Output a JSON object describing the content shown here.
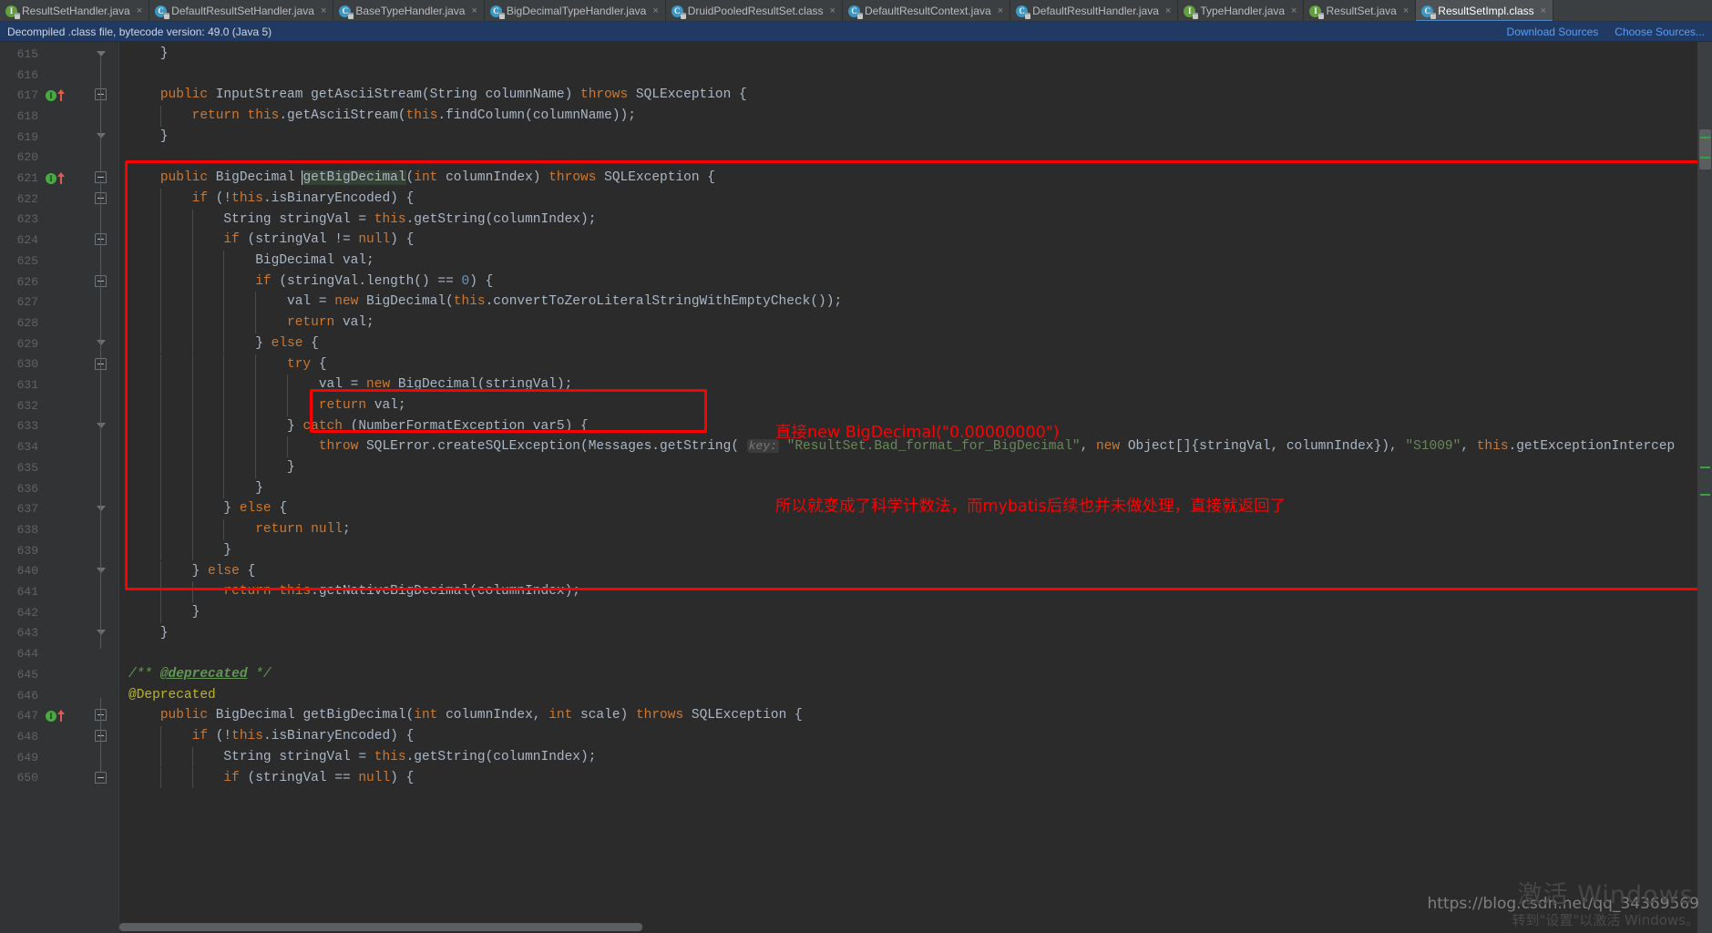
{
  "tabs": [
    {
      "label": "ResultSetHandler.java",
      "icon": "interface-icon",
      "kind": "itf",
      "active": false,
      "closable": true
    },
    {
      "label": "DefaultResultSetHandler.java",
      "icon": "class-icon",
      "kind": "cls",
      "active": false,
      "closable": true
    },
    {
      "label": "BaseTypeHandler.java",
      "icon": "class-icon",
      "kind": "cls",
      "active": false,
      "closable": true
    },
    {
      "label": "BigDecimalTypeHandler.java",
      "icon": "class-icon",
      "kind": "cls",
      "active": false,
      "closable": true
    },
    {
      "label": "DruidPooledResultSet.class",
      "icon": "class-icon",
      "kind": "cls",
      "active": false,
      "closable": true
    },
    {
      "label": "DefaultResultContext.java",
      "icon": "class-icon",
      "kind": "cls",
      "active": false,
      "closable": true
    },
    {
      "label": "DefaultResultHandler.java",
      "icon": "class-icon",
      "kind": "cls",
      "active": false,
      "closable": true
    },
    {
      "label": "TypeHandler.java",
      "icon": "interface-icon",
      "kind": "itf",
      "active": false,
      "closable": true
    },
    {
      "label": "ResultSet.java",
      "icon": "interface-icon",
      "kind": "itf",
      "active": false,
      "closable": true
    },
    {
      "label": "ResultSetImpl.class",
      "icon": "class-icon",
      "kind": "cls",
      "active": true,
      "closable": true
    }
  ],
  "tab_close_glyph": "×",
  "notification": {
    "message": "Decompiled .class file, bytecode version: 49.0 (Java 5)",
    "download_sources_label": "Download Sources",
    "choose_sources_label": "Choose Sources..."
  },
  "editor": {
    "first_line_number": 615,
    "selected_identifier": "getBigDecimal",
    "lines": [
      {
        "n": 615,
        "indent": 1,
        "fold": "endcap",
        "text": "    }"
      },
      {
        "n": 616,
        "indent": 0,
        "text": ""
      },
      {
        "n": 617,
        "indent": 1,
        "gutter": "implements-up",
        "fold": "start",
        "text": "    public InputStream getAsciiStream(String columnName) throws SQLException {"
      },
      {
        "n": 618,
        "indent": 2,
        "text": "        return this.getAsciiStream(this.findColumn(columnName));"
      },
      {
        "n": 619,
        "indent": 1,
        "fold": "endcap",
        "text": "    }"
      },
      {
        "n": 620,
        "indent": 0,
        "text": ""
      },
      {
        "n": 621,
        "indent": 1,
        "gutter": "implements-up",
        "fold": "start",
        "text": "    public BigDecimal getBigDecimal(int columnIndex) throws SQLException {"
      },
      {
        "n": 622,
        "indent": 2,
        "fold": "start",
        "text": "        if (!this.isBinaryEncoded) {"
      },
      {
        "n": 623,
        "indent": 3,
        "text": "            String stringVal = this.getString(columnIndex);"
      },
      {
        "n": 624,
        "indent": 3,
        "fold": "start",
        "text": "            if (stringVal != null) {"
      },
      {
        "n": 625,
        "indent": 4,
        "text": "                BigDecimal val;"
      },
      {
        "n": 626,
        "indent": 4,
        "fold": "start",
        "text": "                if (stringVal.length() == 0) {"
      },
      {
        "n": 627,
        "indent": 5,
        "text": "                    val = new BigDecimal(this.convertToZeroLiteralStringWithEmptyCheck());"
      },
      {
        "n": 628,
        "indent": 5,
        "text": "                    return val;"
      },
      {
        "n": 629,
        "indent": 4,
        "fold": "endcap",
        "text": "                } else {"
      },
      {
        "n": 630,
        "indent": 5,
        "fold": "start",
        "text": "                    try {"
      },
      {
        "n": 631,
        "indent": 6,
        "text": "                        val = new BigDecimal(stringVal);"
      },
      {
        "n": 632,
        "indent": 6,
        "text": "                        return val;"
      },
      {
        "n": 633,
        "indent": 5,
        "fold": "endcap",
        "text": "                    } catch (NumberFormatException var5) {"
      },
      {
        "n": 634,
        "indent": 6,
        "text": "                        throw SQLError.createSQLException(Messages.getString( key: \"ResultSet.Bad_format_for_BigDecimal\", new Object[]{stringVal, columnIndex}), \"S1009\", this.getExceptionIntercep"
      },
      {
        "n": 635,
        "indent": 5,
        "text": "                    }"
      },
      {
        "n": 636,
        "indent": 4,
        "text": "                }"
      },
      {
        "n": 637,
        "indent": 3,
        "fold": "endcap",
        "text": "            } else {"
      },
      {
        "n": 638,
        "indent": 4,
        "text": "                return null;"
      },
      {
        "n": 639,
        "indent": 3,
        "text": "            }"
      },
      {
        "n": 640,
        "indent": 2,
        "fold": "endcap",
        "text": "        } else {"
      },
      {
        "n": 641,
        "indent": 3,
        "text": "            return this.getNativeBigDecimal(columnIndex);"
      },
      {
        "n": 642,
        "indent": 2,
        "text": "        }"
      },
      {
        "n": 643,
        "indent": 1,
        "fold": "endcap",
        "text": "    }"
      },
      {
        "n": 644,
        "indent": 0,
        "text": ""
      },
      {
        "n": 645,
        "indent": 1,
        "text": "    /** @deprecated */"
      },
      {
        "n": 646,
        "indent": 1,
        "text": "    @Deprecated"
      },
      {
        "n": 647,
        "indent": 1,
        "gutter": "implements-up",
        "fold": "start",
        "text": "    public BigDecimal getBigDecimal(int columnIndex, int scale) throws SQLException {"
      },
      {
        "n": 648,
        "indent": 2,
        "fold": "start",
        "text": "        if (!this.isBinaryEncoded) {"
      },
      {
        "n": 649,
        "indent": 3,
        "text": "            String stringVal = this.getString(columnIndex);"
      },
      {
        "n": 650,
        "indent": 3,
        "fold": "start",
        "text": "            if (stringVal == null) {"
      }
    ]
  },
  "annotations": {
    "note_line_1": "直接new BigDecimal(\"0.00000000\")",
    "note_line_2": "所以就变成了科学计数法，而mybatis后续也并未做处理，直接就返回了",
    "note_color": "#ff0000",
    "outer_box_label": "method-highlight-box",
    "inner_box_label": "bigdecimal-construction-box"
  },
  "watermark": {
    "activate_windows_title": "激活 Windows",
    "activate_windows_subtitle": "转到\"设置\"以激活 Windows。",
    "blog_url": "https://blog.csdn.net/qq_34369569"
  }
}
